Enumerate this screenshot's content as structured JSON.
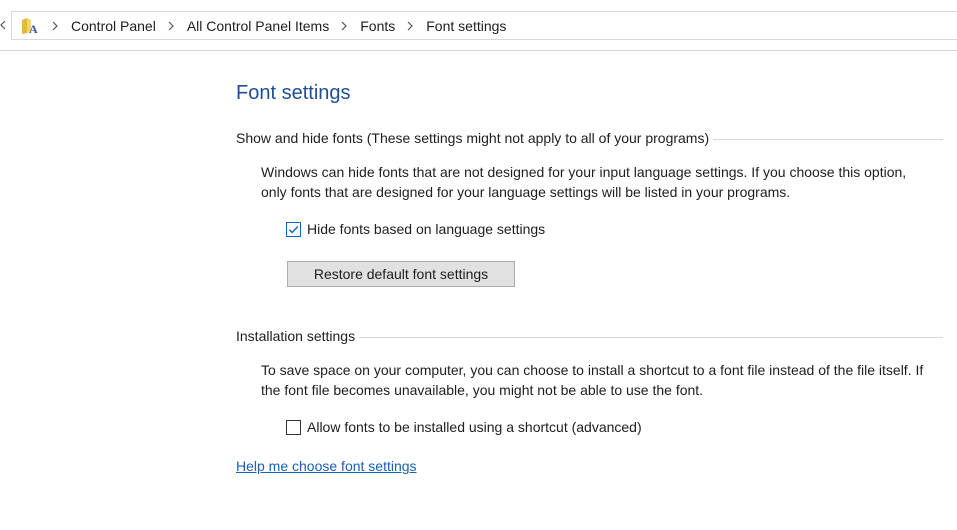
{
  "breadcrumb": {
    "items": [
      "Control Panel",
      "All Control Panel Items",
      "Fonts",
      "Font settings"
    ]
  },
  "page": {
    "title": "Font settings"
  },
  "show_hide": {
    "heading": "Show and hide fonts (These settings might not apply to all of your programs)",
    "description": "Windows can hide fonts that are not designed for your input language settings. If you choose this option, only fonts that are designed for your language settings will be listed in your programs.",
    "checkbox_label": "Hide fonts based on language settings",
    "checkbox_checked": true,
    "restore_button": "Restore default font settings"
  },
  "installation": {
    "heading": "Installation settings",
    "description": "To save space on your computer, you can choose to install a shortcut to a font file instead of the file itself. If the font file becomes unavailable, you might not be able to use the font.",
    "checkbox_label": "Allow fonts to be installed using a shortcut (advanced)",
    "checkbox_checked": false
  },
  "help_link": "Help me choose font settings",
  "colors": {
    "title": "#1f4e96",
    "link": "#1a5fb4",
    "check_accent": "#0a64c8"
  }
}
